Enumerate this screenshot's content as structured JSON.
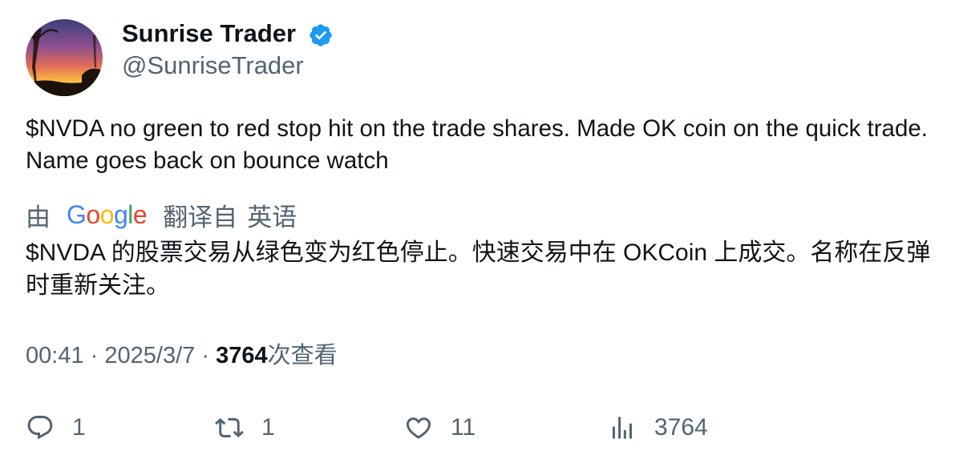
{
  "author": {
    "display_name": "Sunrise Trader",
    "handle": "@SunriseTrader",
    "verified": true,
    "verified_color": "#1D9BF0"
  },
  "tweet": {
    "text": "$NVDA no green to red stop hit on the trade shares. Made OK coin on the quick trade. Name goes back on bounce watch"
  },
  "translation": {
    "by_label": "由",
    "provider": "Google",
    "from_label": "翻译自",
    "language": "英语",
    "translated_text": "$NVDA 的股票交易从绿色变为红色停止。快速交易中在 OKCoin 上成交。名称在反弹时重新关注。"
  },
  "meta": {
    "time": "00:41",
    "separator": "·",
    "date": "2025/3/7",
    "views_count": "3764",
    "views_label": "次查看"
  },
  "actions": {
    "replies": "1",
    "retweets": "1",
    "likes": "11",
    "views": "3764"
  },
  "icons": {
    "verified": "verified-badge-icon",
    "reply": "reply-icon",
    "retweet": "retweet-icon",
    "like": "heart-icon",
    "views": "bar-chart-icon"
  },
  "colors": {
    "text_primary": "#0f1419",
    "text_secondary": "#536471",
    "accent": "#1D9BF0"
  }
}
